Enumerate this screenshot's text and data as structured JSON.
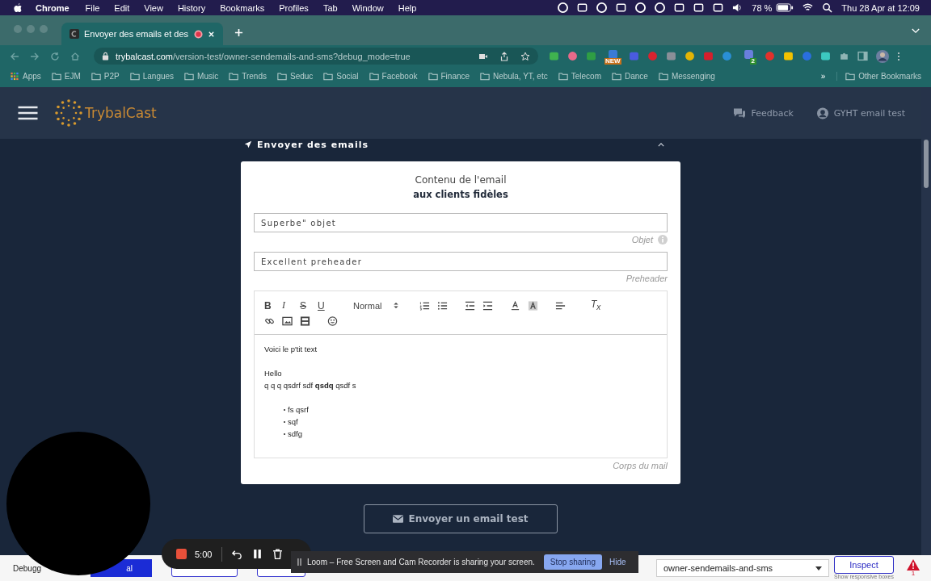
{
  "menubar": {
    "app": "Chrome",
    "menus": [
      "File",
      "Edit",
      "View",
      "History",
      "Bookmarks",
      "Profiles",
      "Tab",
      "Window",
      "Help"
    ],
    "battery": "78 %",
    "clock": "Thu 28 Apr at 12:09"
  },
  "browser": {
    "tab": {
      "title": "Envoyer des emails et des",
      "recording": true
    },
    "url_domain": "trybalcast.com",
    "url_path": "/version-test/owner-sendemails-and-sms?debug_mode=true",
    "extension_badges": [
      "NEW",
      "2"
    ],
    "bookmarks": [
      "Apps",
      "EJM",
      "P2P",
      "Langues",
      "Music",
      "Trends",
      "Seduc",
      "Social",
      "Facebook",
      "Finance",
      "Nebula, YT, etc",
      "Telecom",
      "Dance",
      "Messenging"
    ],
    "bookmarks_more": "»",
    "other_bookmarks": "Other Bookmarks"
  },
  "app": {
    "brand": "TrybalCast",
    "feedback": "Feedback",
    "user": "GYHT email test"
  },
  "section": {
    "title": "Envoyer des emails",
    "expanded": true
  },
  "card": {
    "title": "Contenu de l'email",
    "subtitle": "aux clients fidèles",
    "fields": [
      {
        "value": "Superbe\" objet",
        "hint": "Objet",
        "info": true
      },
      {
        "value": "Excellent preheader",
        "hint": "Preheader",
        "info": false
      }
    ],
    "editor": {
      "format_buttons": [
        "B",
        "I",
        "S",
        "U"
      ],
      "size": "Normal",
      "clear_format": "T$_{x}$",
      "hint": "Corps du mail",
      "blocks": [
        {
          "kind": "paragraph",
          "text": "Voici le p'tit text"
        },
        {
          "kind": "blank"
        },
        {
          "kind": "paragraph",
          "text": "Hello"
        },
        {
          "kind": "paragraph",
          "text": "q q q qsdrf sdf **qsdq** qsdf s"
        },
        {
          "kind": "blank"
        },
        {
          "kind": "bullets",
          "items": [
            "fs qsrf",
            "sqf",
            "sdfg"
          ]
        }
      ]
    }
  },
  "test_button": "Envoyer un email test",
  "debug_bar": {
    "label": "Debugg",
    "button": "al",
    "page_select": "owner-sendemails-and-sms",
    "inspect": "Inspect",
    "inspect_hint": "Show responsive boxes",
    "warnings": "1"
  },
  "recorder": {
    "time": "5:00"
  },
  "loom": {
    "message": "Loom – Free Screen and Cam Recorder is sharing your screen.",
    "stop": "Stop sharing",
    "hide": "Hide"
  }
}
